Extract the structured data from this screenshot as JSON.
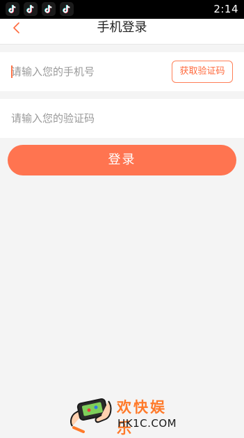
{
  "status_bar": {
    "time": "2:14",
    "notification_icons": [
      "tiktok-icon",
      "tiktok-icon",
      "tiktok-icon",
      "tiktok-icon"
    ]
  },
  "header": {
    "title": "手机登录",
    "back_icon": "chevron-left-icon"
  },
  "form": {
    "phone": {
      "placeholder": "请输入您的手机号",
      "value": ""
    },
    "get_code_label": "获取验证码",
    "code": {
      "placeholder": "请输入您的验证码",
      "value": ""
    },
    "login_label": "登录"
  },
  "watermark": {
    "name_cn": "欢快娱乐",
    "name_en": "HK1C.COM"
  },
  "colors": {
    "accent": "#ff7450",
    "background": "#f4f4f4",
    "status_bar": "#000000"
  }
}
